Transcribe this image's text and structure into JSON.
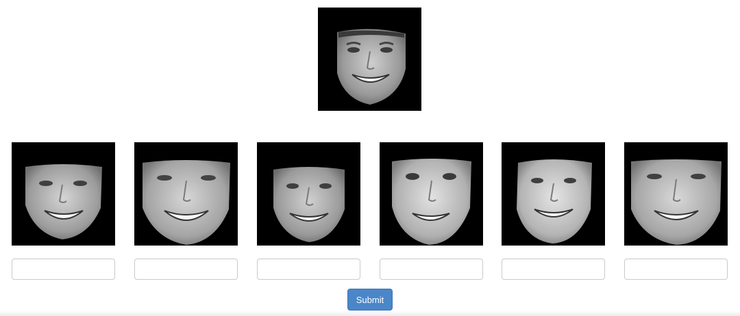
{
  "target_face": {
    "icon": "face-photo-icon"
  },
  "choices": [
    {
      "icon": "face-photo-icon",
      "value": "",
      "placeholder": ""
    },
    {
      "icon": "face-photo-icon",
      "value": "",
      "placeholder": ""
    },
    {
      "icon": "face-photo-icon",
      "value": "",
      "placeholder": ""
    },
    {
      "icon": "face-photo-icon",
      "value": "",
      "placeholder": ""
    },
    {
      "icon": "face-photo-icon",
      "value": "",
      "placeholder": ""
    },
    {
      "icon": "face-photo-icon",
      "value": "",
      "placeholder": ""
    }
  ],
  "submit": {
    "label": "Submit"
  },
  "colors": {
    "photo_background": "#000000",
    "button": "#4a86c8",
    "input_border": "#c9c9c9"
  }
}
